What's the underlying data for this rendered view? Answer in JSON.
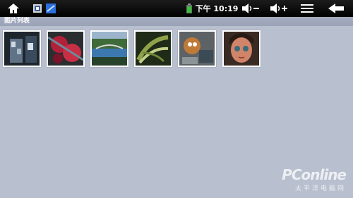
{
  "status_bar": {
    "home_icon": "home-icon",
    "app_icons": [
      "screenshot-app-icon",
      "photo-app-icon"
    ],
    "battery_icon": "battery-icon",
    "time": "下午 10:19",
    "volume_down_icon": "volume-down-icon",
    "volume_up_icon": "volume-up-icon",
    "menu_icon": "menu-icon",
    "back_icon": "back-arrow-icon"
  },
  "section": {
    "title": "图片列表"
  },
  "thumbnails": [
    {
      "icon": "thumbnail-ice-drink",
      "accent": "#3a4b5e"
    },
    {
      "icon": "thumbnail-red-flowers",
      "accent": "#b3203a"
    },
    {
      "icon": "thumbnail-river-landscape",
      "accent": "#3c78b0"
    },
    {
      "icon": "thumbnail-green-leaves",
      "accent": "#8fa24a"
    },
    {
      "icon": "thumbnail-cartoon-art",
      "accent": "#c07a38"
    },
    {
      "icon": "thumbnail-anime-girl",
      "accent": "#d0856a"
    }
  ],
  "watermark": {
    "logo": "PConline",
    "sub": "太平洋电脑网"
  }
}
